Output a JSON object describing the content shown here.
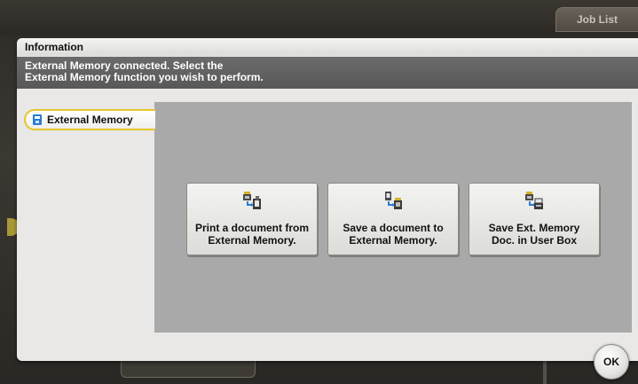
{
  "header": {
    "job_list_label": "Job List"
  },
  "dialog": {
    "title": "Information",
    "message_line1": "External Memory connected. Select the",
    "message_line2": "External Memory function you wish to perform.",
    "side_tab_label": "External Memory",
    "side_tab_icon": "usb-memory-icon",
    "functions": [
      {
        "line1": "Print a document from",
        "line2": "External Memory.",
        "icon": "print-from-memory-icon"
      },
      {
        "line1": "Save a document to",
        "line2": "External Memory.",
        "icon": "save-to-memory-icon"
      },
      {
        "line1": "Save Ext. Memory",
        "line2": "Doc. in User Box",
        "icon": "save-to-user-box-icon"
      }
    ],
    "ok_label": "OK"
  },
  "colors": {
    "accent_tab_border": "#e6c62a",
    "content_area": "#a9a9a9",
    "message_bar": "#606060",
    "arrow_blue": "#2a7bd6"
  }
}
